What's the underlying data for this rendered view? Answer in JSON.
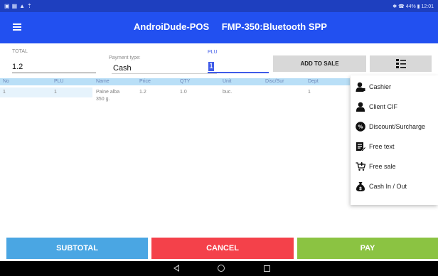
{
  "status_bar": {
    "left_icons": [
      "image-icon",
      "calendar-icon",
      "alarm-icon",
      "upload-icon"
    ],
    "right_text": "✱ ☎ 44% ▮ 12:01"
  },
  "app_bar": {
    "title": "AndroiDude-POS",
    "device": "FMP-350:Bluetooth SPP",
    "menu_icon": "hamburger-menu-icon"
  },
  "form": {
    "total_label": "TOTAL",
    "total_value": "1.2",
    "payment_label": "Payment type:",
    "payment_value": "Cash",
    "plu_label": "PLU",
    "plu_value": "1",
    "add_button": "ADD TO SALE",
    "list_icon": "numbered-list-icon"
  },
  "table": {
    "columns": [
      "No",
      "PLU",
      "Name",
      "Price",
      "QTY",
      "Unit",
      "Disc/Sur",
      "Dept"
    ],
    "rows": [
      {
        "no": "1",
        "plu": "1",
        "name_line1": "Paine alba",
        "name_line2": "350 g.",
        "price": "1.2",
        "qty": "1.0",
        "unit": "buc.",
        "disc": "",
        "dept": "1"
      }
    ]
  },
  "menu": {
    "items": [
      {
        "label": "Cashier",
        "icon": "cashier-user-icon"
      },
      {
        "label": "Client CIF",
        "icon": "client-badge-icon"
      },
      {
        "label": "Discount/Surcharge",
        "icon": "percent-icon"
      },
      {
        "label": "Free text",
        "icon": "edit-note-icon"
      },
      {
        "label": "Free sale",
        "icon": "cart-add-icon"
      },
      {
        "label": "Cash In / Out",
        "icon": "money-bag-icon"
      }
    ]
  },
  "buttons": {
    "subtotal": "SUBTOTAL",
    "cancel": "CANCEL",
    "pay": "PAY"
  },
  "colors": {
    "app_bar": "#2250f0",
    "status_bar": "#1e3fbf",
    "subtotal": "#4aa6e3",
    "cancel": "#f4414a",
    "pay": "#8bc342",
    "table_header": "#b9dff7",
    "accent": "#3f5be8"
  }
}
